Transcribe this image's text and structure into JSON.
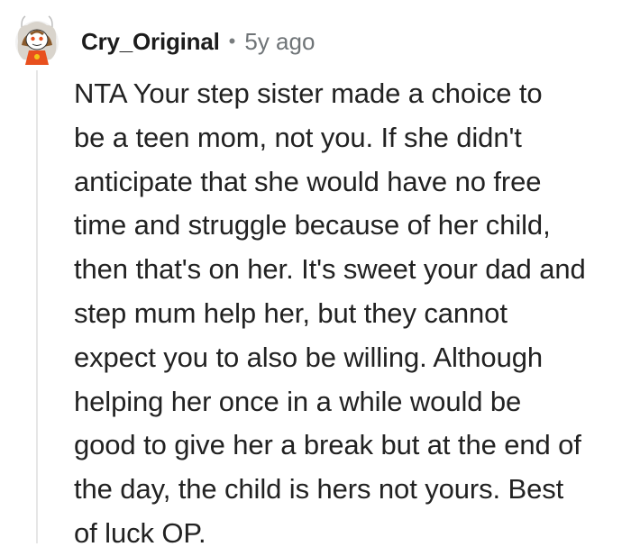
{
  "comment": {
    "author": "Cry_Original",
    "separator": "•",
    "age": "5y ago",
    "avatar_icon": "snoo-avatar-icon",
    "accent_color": "#e8501e",
    "body_lines": [
      "NTA Your step sister made a choice to",
      "be a teen mom, not you. If she didn't",
      "anticipate that she would have no free",
      "time and struggle because of her child,",
      "then that's on her. It's sweet your dad and",
      "step mum help her, but they cannot",
      "expect you to also be willing. Although",
      "helping her once in a while would be",
      "good to give her a break but at the end of",
      "the day, the child is hers not yours. Best",
      "of luck OP."
    ]
  }
}
